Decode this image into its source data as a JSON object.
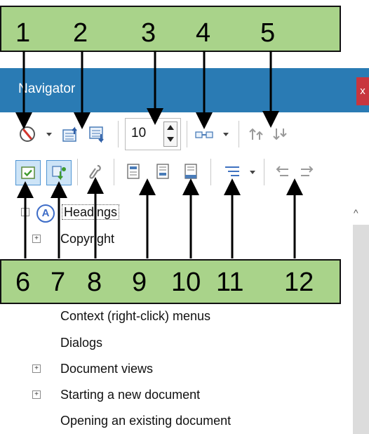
{
  "window": {
    "title": "Navigator",
    "close_label": "x"
  },
  "toolbar": {
    "spin_value": "10"
  },
  "tree": {
    "items": [
      {
        "label": "Headings",
        "level": 0,
        "expander": "-"
      },
      {
        "label": "Copyright",
        "level": 1,
        "expander": "+"
      },
      {
        "label": "Context (right-click) menus",
        "level": 1,
        "expander": ""
      },
      {
        "label": "Dialogs",
        "level": 1,
        "expander": ""
      },
      {
        "label": "Document views",
        "level": 1,
        "expander": "+"
      },
      {
        "label": "Starting a new document",
        "level": 1,
        "expander": "+"
      },
      {
        "label": "Opening an existing document",
        "level": 1,
        "expander": ""
      }
    ]
  },
  "callouts": {
    "top": [
      "1",
      "2",
      "3",
      "4",
      "5"
    ],
    "bottom": [
      "6",
      "7",
      "8",
      "9",
      "10",
      "11",
      "12"
    ]
  },
  "colors": {
    "titlebar": "#2a7bb4",
    "callout_bg": "#a9d38a",
    "close_bg": "#c8363e"
  },
  "icons": {
    "row1": [
      "navigation-compass-icon",
      "previous-item-icon",
      "next-item-icon",
      "drag-mode-icon",
      "promote-level-icon",
      "demote-level-icon"
    ],
    "row2": [
      "toggle-master-view-icon",
      "set-reminder-icon",
      "insert-link-icon",
      "header-icon",
      "footer-icon",
      "anchor-to-anchor-icon",
      "heading-levels-shown-icon",
      "promote-chapter-icon",
      "demote-chapter-icon"
    ]
  }
}
